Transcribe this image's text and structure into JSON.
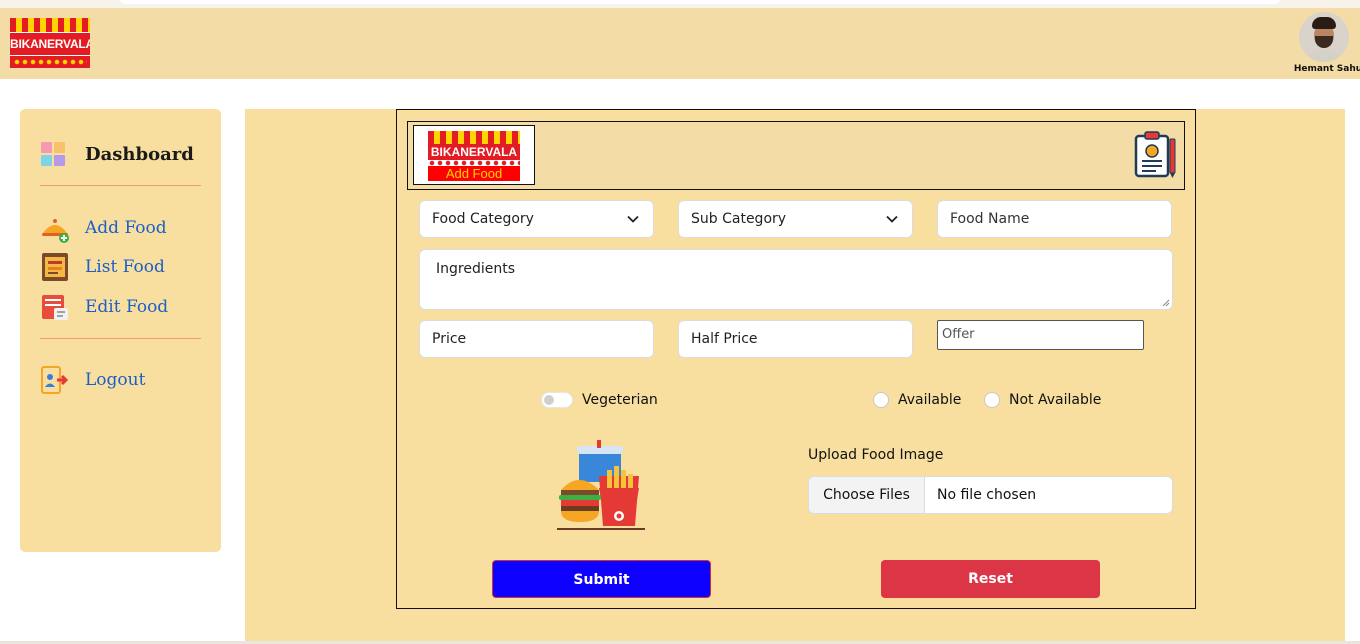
{
  "header": {
    "brand": "BIKANERVALA",
    "user_name": "Hemant Sahu"
  },
  "sidebar": {
    "dashboard_label": "Dashboard",
    "items": [
      {
        "label": "Add Food",
        "icon": "add-food-icon"
      },
      {
        "label": "List Food",
        "icon": "list-food-icon"
      },
      {
        "label": "Edit Food",
        "icon": "edit-food-icon"
      }
    ],
    "logout_label": "Logout"
  },
  "form": {
    "logo_brand": "BIKANERVALA",
    "logo_caption": "Add Food",
    "food_category": "Food Category",
    "sub_category": "Sub Category",
    "food_name_placeholder": "Food Name",
    "ingredients_placeholder": "Ingredients",
    "price_placeholder": "Price",
    "half_price_placeholder": "Half Price",
    "offer_placeholder": "Offer",
    "veg_label": "Vegeterian",
    "veg_on": false,
    "available_label": "Available",
    "not_available_label": "Not Available",
    "upload_title": "Upload Food Image",
    "choose_files": "Choose Files",
    "file_status": "No file chosen",
    "submit_label": "Submit",
    "reset_label": "Reset"
  },
  "colors": {
    "header_bg": "#f3dca6",
    "panel_bg": "#f8dfa0",
    "link": "#1a5fc8",
    "submit": "#0d00ff",
    "reset": "#dc3545"
  }
}
